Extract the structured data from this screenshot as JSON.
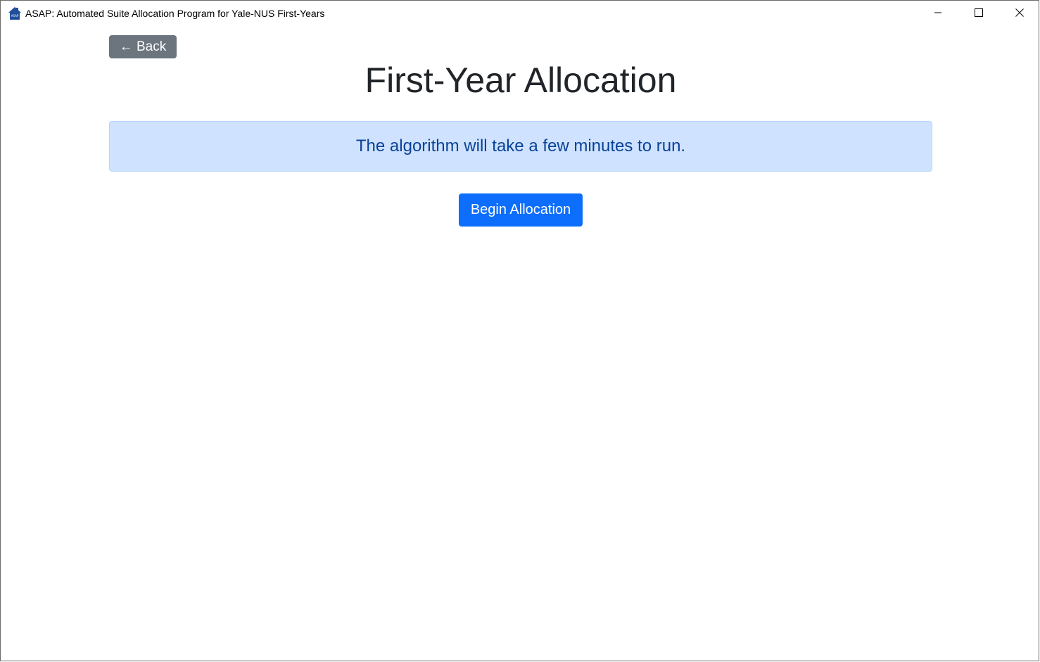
{
  "window": {
    "title": "ASAP: Automated Suite Allocation Program for Yale-NUS First-Years",
    "icon": "asap-house-icon",
    "controls": [
      "minimize-icon",
      "maximize-icon",
      "close-icon"
    ]
  },
  "page": {
    "back_label": "← Back",
    "title": "First-Year Allocation",
    "info_message": "The algorithm will take a few minutes to run.",
    "begin_label": "Begin Allocation"
  },
  "colors": {
    "back_button": "#6c757d",
    "alert_bg": "#cfe2ff",
    "alert_text": "#084298",
    "primary_button": "#0d6efd",
    "app_icon": "#1f4e9c"
  }
}
